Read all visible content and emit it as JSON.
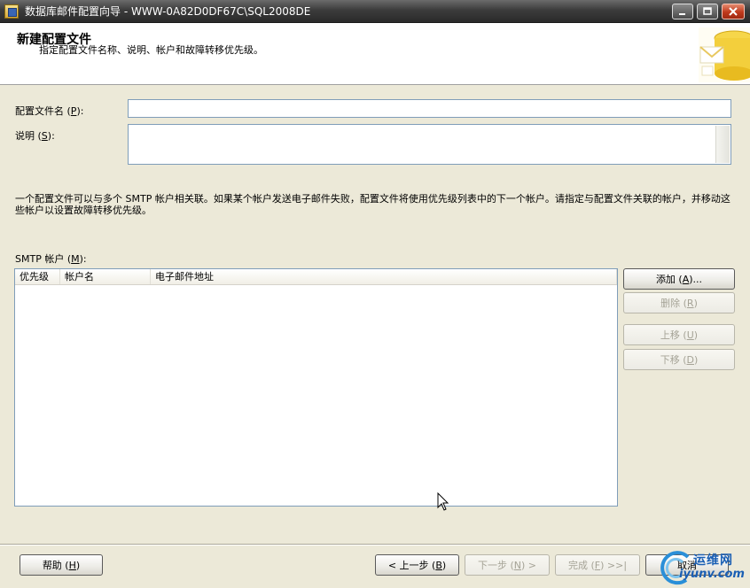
{
  "window": {
    "title": "数据库邮件配置向导 - WWW-0A82D0DF67C\\SQL2008DE"
  },
  "header": {
    "title": "新建配置文件",
    "subtitle": "指定配置文件名称、说明、帐户和故障转移优先级。"
  },
  "form": {
    "profile_name": {
      "label_prefix": "配置文件名 (",
      "label_key": "P",
      "label_suffix": "):",
      "value": ""
    },
    "description": {
      "label_prefix": "说明 (",
      "label_key": "S",
      "label_suffix": "):",
      "value": ""
    }
  },
  "info_text": "一个配置文件可以与多个 SMTP 帐户相关联。如果某个帐户发送电子邮件失败，配置文件将使用优先级列表中的下一个帐户。请指定与配置文件关联的帐户，并移动这些帐户以设置故障转移优先级。",
  "smtp": {
    "label_prefix": "SMTP 帐户 (",
    "label_key": "M",
    "label_suffix": "):",
    "columns": [
      "优先级",
      "帐户名",
      "电子邮件地址"
    ],
    "rows": []
  },
  "side_buttons": {
    "add": {
      "prefix": "添加 (",
      "key": "A",
      "suffix": ")..."
    },
    "remove": {
      "prefix": "删除 (",
      "key": "R",
      "suffix": ")"
    },
    "up": {
      "prefix": "上移 (",
      "key": "U",
      "suffix": ")"
    },
    "down": {
      "prefix": "下移 (",
      "key": "D",
      "suffix": ")"
    }
  },
  "footer": {
    "help": {
      "prefix": "帮助 (",
      "key": "H",
      "suffix": ")"
    },
    "back": {
      "prefix": "< 上一步 (",
      "key": "B",
      "suffix": ")"
    },
    "next": {
      "prefix": "下一步 (",
      "key": "N",
      "suffix": ") >"
    },
    "finish": {
      "prefix": "完成 (",
      "key": "F",
      "suffix": ") >>|"
    },
    "cancel": "取消"
  },
  "watermark": {
    "top": "运维网",
    "bottom": "iyunv.com"
  },
  "colors": {
    "titlebar": "#3c3c3c",
    "dialog_bg": "#ece9d8",
    "border": "#7f9db9",
    "disabled_text": "#a5a396",
    "watermark": "#1a5fb4"
  }
}
